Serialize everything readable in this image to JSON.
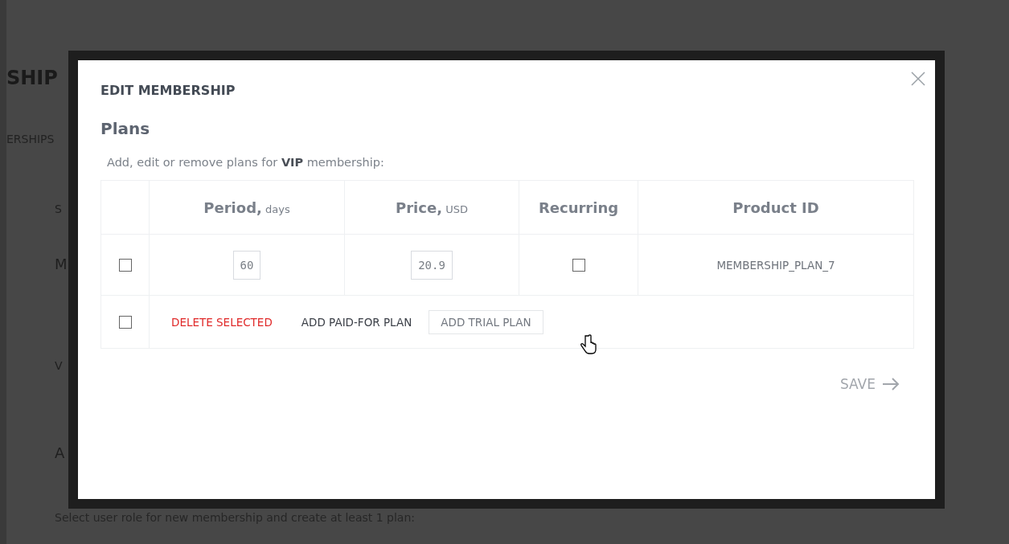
{
  "background_page": {
    "title": "SHIP",
    "tab": "ERSHIPS",
    "fragments": [
      "S",
      "M",
      "V",
      "A"
    ],
    "note": "Select user role for new membership and create at least 1 plan:"
  },
  "modal": {
    "title": "EDIT MEMBERSHIP",
    "heading": "Plans",
    "description": "Add, edit or remove plans for **VIP** membership:",
    "columns": [
      {
        "label": "Period,",
        "unit": "days"
      },
      {
        "label": "Price,",
        "unit": "USD"
      },
      {
        "label": "Recurring"
      },
      {
        "label": "Product ID"
      }
    ],
    "rows": [
      {
        "checked": false,
        "period": "60",
        "price": "20.9",
        "recurring": false,
        "product_id": "MEMBERSHIP_PLAN_7"
      }
    ],
    "footer_row": {
      "checked": false,
      "actions": [
        {
          "label": "DELETE SELECTED",
          "kind": "danger"
        },
        {
          "label": "ADD PAID-FOR PLAN",
          "kind": "plain"
        },
        {
          "label": "ADD TRIAL PLAN",
          "kind": "outlined"
        }
      ]
    },
    "save": {
      "label": "SAVE"
    }
  }
}
